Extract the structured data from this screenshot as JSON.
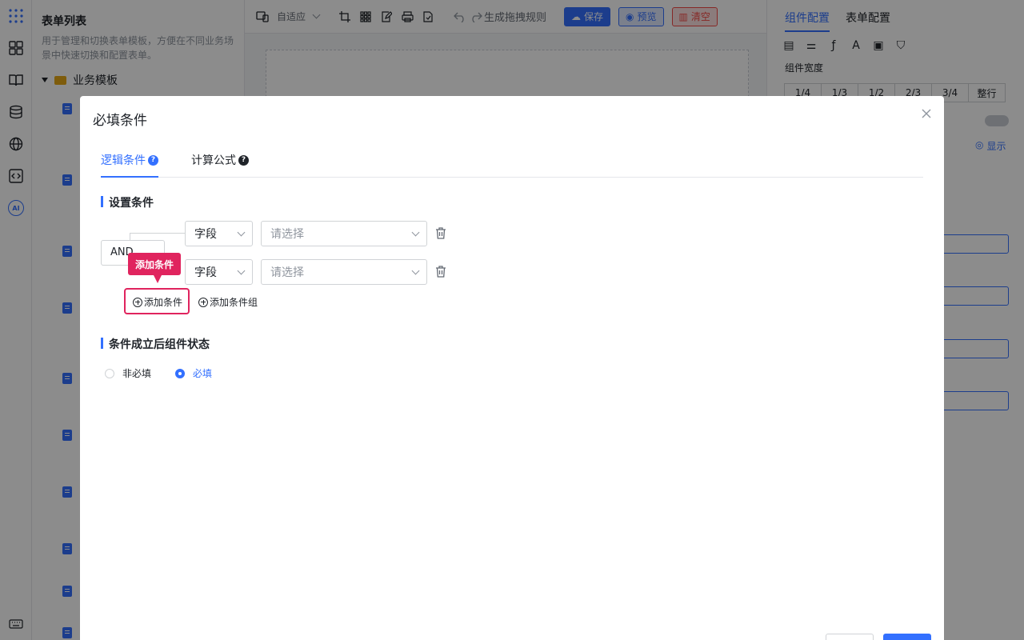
{
  "app": {
    "tree_title": "表单列表",
    "tree_desc": "用于管理和切换表单模板，方便在不同业务场景中快速切换和配置表单。",
    "folder_label": "业务模板"
  },
  "toolbar": {
    "layout_label": "自适应",
    "rule_label": "生成拖拽规则",
    "save_label": "保存",
    "preview_label": "预览",
    "clear_label": "清空"
  },
  "right_panel": {
    "tab_component": "组件配置",
    "tab_form": "表单配置",
    "width_label": "组件宽度",
    "width_options": [
      "1/4",
      "1/3",
      "1/2",
      "2/3",
      "3/4",
      "整行"
    ],
    "show_label": "显示"
  },
  "modal": {
    "title": "必填条件",
    "tabs": [
      {
        "label": "逻辑条件",
        "active": true
      },
      {
        "label": "计算公式",
        "active": false
      }
    ],
    "section_conditions": "设置条件",
    "logic_operator": "AND",
    "conditions": [
      {
        "field_type": "字段",
        "value_placeholder": "请选择"
      },
      {
        "field_type": "字段",
        "value_placeholder": "请选择"
      }
    ],
    "add_condition": "添加条件",
    "add_condition_group": "添加条件组",
    "callout": "添加条件",
    "section_state": "条件成立后组件状态",
    "state_options": [
      {
        "label": "非必填",
        "checked": false
      },
      {
        "label": "必填",
        "checked": true
      }
    ]
  },
  "colors": {
    "accent": "#3370ff",
    "highlight": "#e0245e",
    "danger": "#f54a45"
  }
}
